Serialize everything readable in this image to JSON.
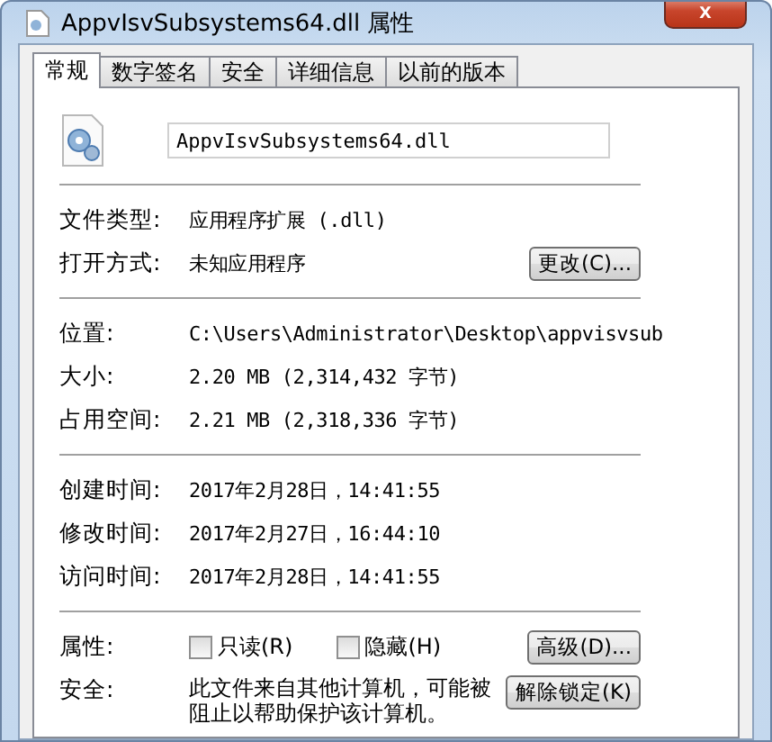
{
  "window": {
    "title": "AppvIsvSubsystems64.dll 属性",
    "close": "x"
  },
  "tabs": [
    {
      "label": "常规",
      "selected": true
    },
    {
      "label": "数字签名",
      "selected": false
    },
    {
      "label": "安全",
      "selected": false
    },
    {
      "label": "详细信息",
      "selected": false
    },
    {
      "label": "以前的版本",
      "selected": false
    }
  ],
  "file_name": "AppvIsvSubsystems64.dll",
  "type_rows": [
    {
      "label": "文件类型:",
      "value": "应用程序扩展 (.dll)"
    },
    {
      "label": "打开方式:",
      "value": "未知应用程序",
      "button": "更改(C)..."
    }
  ],
  "size_rows": [
    {
      "label": "位置:",
      "value": "C:\\Users\\Administrator\\Desktop\\appvisvsub"
    },
    {
      "label": "大小:",
      "value": "2.20 MB (2,314,432 字节)"
    },
    {
      "label": "占用空间:",
      "value": "2.21 MB (2,318,336 字节)"
    }
  ],
  "time_rows": [
    {
      "label": "创建时间:",
      "value": "2017年2月28日，14:41:55"
    },
    {
      "label": "修改时间:",
      "value": "2017年2月27日，16:44:10"
    },
    {
      "label": "访问时间:",
      "value": "2017年2月28日，14:41:55"
    }
  ],
  "attributes": {
    "label": "属性:",
    "checkboxes": [
      {
        "label": "只读(R)",
        "checked": false
      },
      {
        "label": "隐藏(H)",
        "checked": false
      }
    ],
    "button": "高级(D)..."
  },
  "security": {
    "label": "安全:",
    "text": "此文件来自其他计算机，可能被阻止以帮助保护该计算机。",
    "button": "解除锁定(K)"
  }
}
